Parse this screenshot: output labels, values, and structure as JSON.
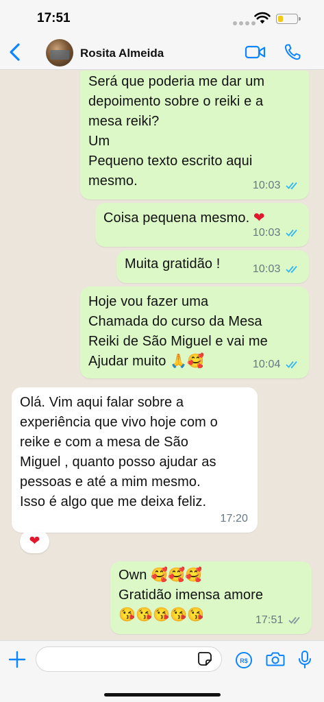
{
  "status_bar": {
    "time": "17:51"
  },
  "header": {
    "contact_name": "Rosita Almeida"
  },
  "messages": [
    {
      "direction": "outgoing",
      "text": "Será que poderia me dar um\ndepoimento sobre o reiki e a\nmesa reiki?\nUm\nPequeno texto escrito aqui\nmesmo.",
      "time": "10:03",
      "status": "read"
    },
    {
      "direction": "outgoing",
      "text": "Coisa pequena mesmo.",
      "emoji": "❤",
      "time": "10:03",
      "status": "read"
    },
    {
      "direction": "outgoing",
      "text": "Muita gratidão !",
      "time": "10:03",
      "status": "read"
    },
    {
      "direction": "outgoing",
      "text": "Hoje vou fazer uma\nChamada do curso da Mesa\nReiki de São Miguel e vai me\nAjudar muito",
      "emoji": "🙏🥰",
      "time": "10:04",
      "status": "read"
    },
    {
      "direction": "incoming",
      "text": "Olá. Vim aqui falar sobre a\nexperiência que vivo hoje com o\nreike e com a mesa de São\nMiguel , quanto posso ajudar as\npessoas e  até  a mim mesmo.\nIsso é algo que me deixa feliz.",
      "time": "17:20",
      "reaction": "❤"
    },
    {
      "direction": "outgoing",
      "text_line1": "Own",
      "emoji_line1": "🥰🥰🥰",
      "text_line2": "Gratidão imensa amore",
      "emoji_line3": "😘😘😘😘😘",
      "time": "17:51",
      "status": "delivered"
    }
  ],
  "input": {
    "placeholder": ""
  },
  "colors": {
    "outgoing_bubble": "#dbf8c6",
    "incoming_bubble": "#ffffff",
    "chat_background": "#ece5dc",
    "accent": "#0a84ff",
    "read_ticks": "#34b7f1",
    "delivered_ticks": "#8696a0"
  }
}
